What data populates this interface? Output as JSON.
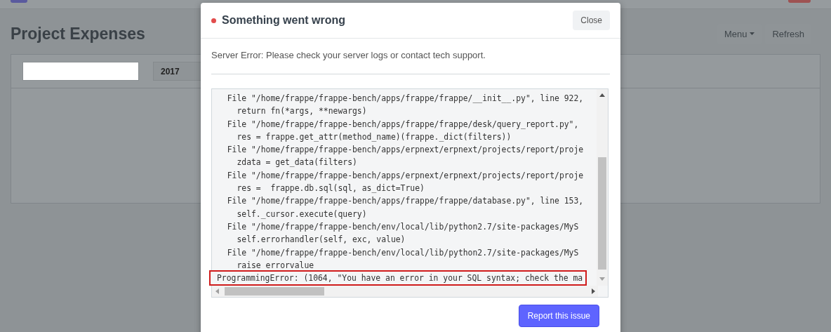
{
  "page": {
    "title": "Project Expenses",
    "buttons": [
      {
        "label": "Menu",
        "kind": "dropdown"
      },
      {
        "label": "Refresh",
        "kind": "plain"
      }
    ],
    "filters": [
      {
        "kind": "input"
      },
      {
        "kind": "select",
        "value": "2017"
      }
    ]
  },
  "dialog": {
    "title": "Something went wrong",
    "indicator": {
      "color": "#e24c4c"
    },
    "close_label": "Close",
    "message": "Server Error: Please check your server logs or contact tech support.",
    "traceback": [
      {
        "text": "  File \"/home/frappe/frappe-bench/apps/frappe/frappe/__init__.py\", line 922,",
        "highlighted": false
      },
      {
        "text": "    return fn(*args, **newargs)",
        "highlighted": false
      },
      {
        "text": "  File \"/home/frappe/frappe-bench/apps/frappe/frappe/desk/query_report.py\",",
        "highlighted": false
      },
      {
        "text": "    res = frappe.get_attr(method_name)(frappe._dict(filters))",
        "highlighted": false
      },
      {
        "text": "  File \"/home/frappe/frappe-bench/apps/erpnext/erpnext/projects/report/proje",
        "highlighted": false
      },
      {
        "text": "    zdata = get_data(filters)",
        "highlighted": false
      },
      {
        "text": "  File \"/home/frappe/frappe-bench/apps/erpnext/erpnext/projects/report/proje",
        "highlighted": false
      },
      {
        "text": "    res =  frappe.db.sql(sql, as_dict=True)",
        "highlighted": false
      },
      {
        "text": "  File \"/home/frappe/frappe-bench/apps/frappe/frappe/database.py\", line 153,",
        "highlighted": false
      },
      {
        "text": "    self._cursor.execute(query)",
        "highlighted": false
      },
      {
        "text": "  File \"/home/frappe/frappe-bench/env/local/lib/python2.7/site-packages/MyS",
        "highlighted": false
      },
      {
        "text": "    self.errorhandler(self, exc, value)",
        "highlighted": false
      },
      {
        "text": "  File \"/home/frappe/frappe-bench/env/local/lib/python2.7/site-packages/MyS",
        "highlighted": false
      },
      {
        "text": "    raise errorvalue",
        "highlighted": false
      },
      {
        "text": "ProgrammingError: (1064, \"You have an error in your SQL syntax; check the ma",
        "highlighted": true
      }
    ],
    "report_label": "Report this issue"
  }
}
